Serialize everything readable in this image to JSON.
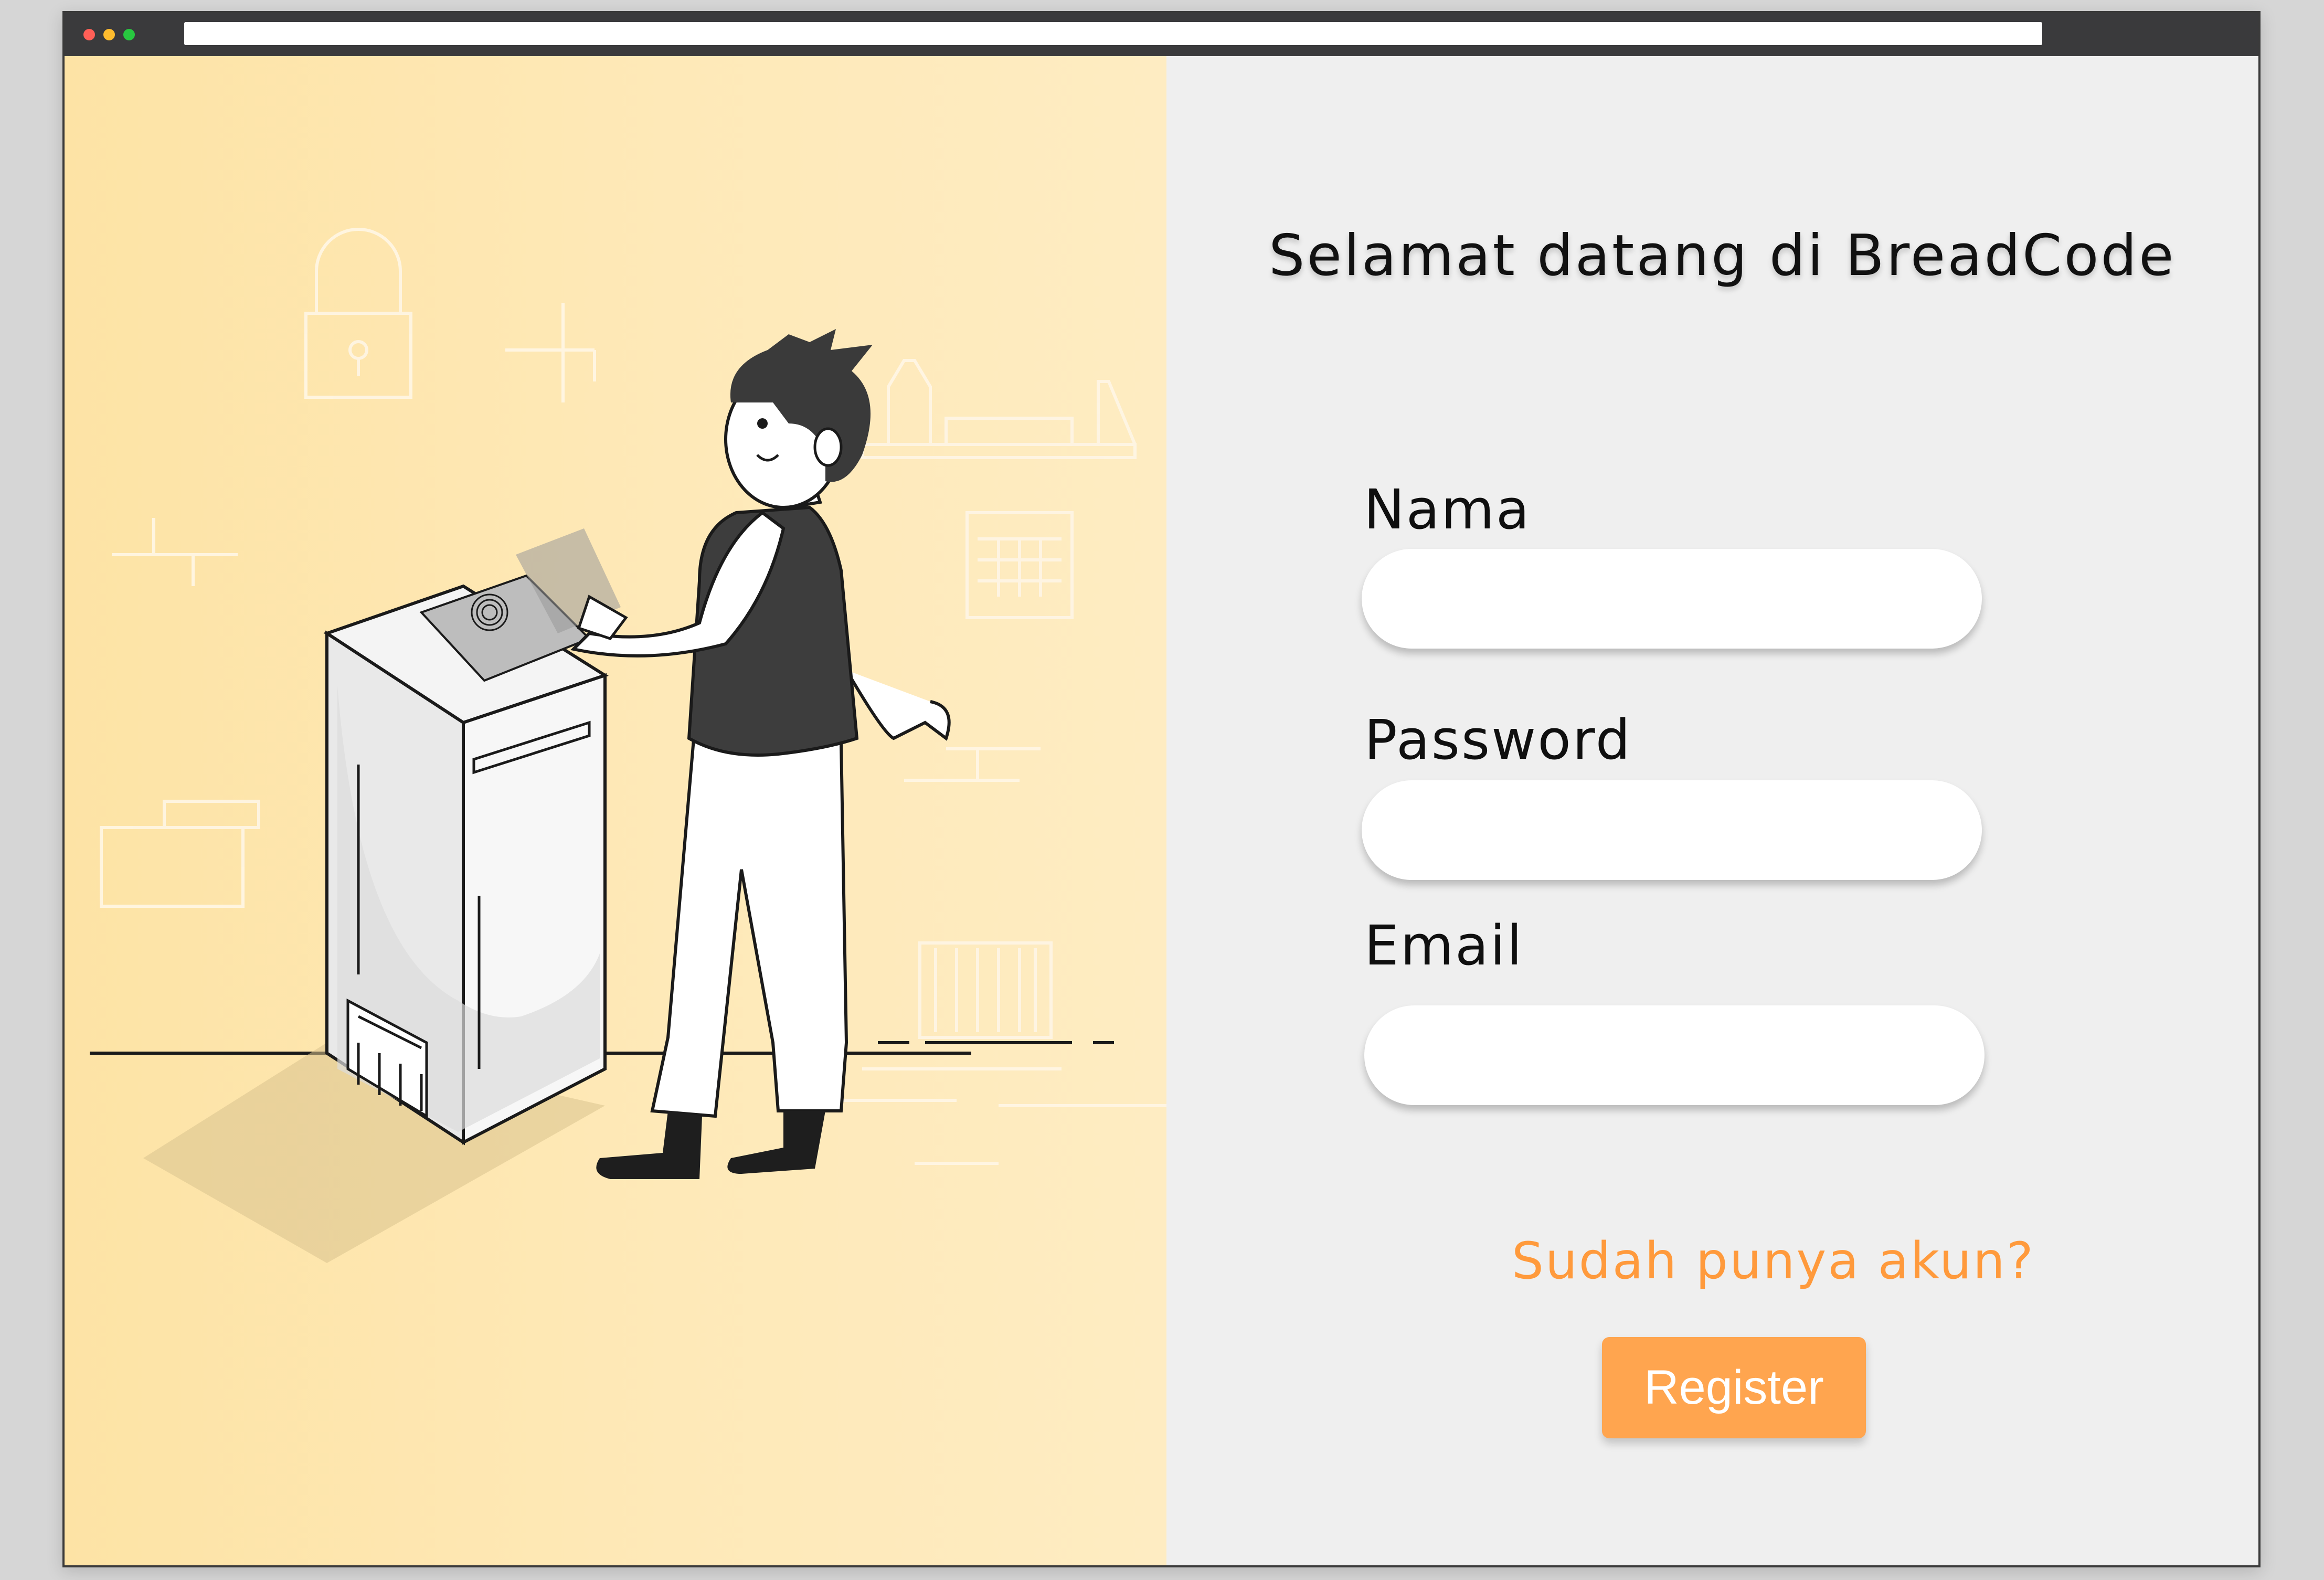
{
  "browser": {
    "window_controls": [
      "close",
      "minimize",
      "maximize"
    ],
    "address": ""
  },
  "illustration": {
    "subject": "person scanning fingerprint at kiosk",
    "icons": [
      "padlock-icon",
      "fingerprint-icon",
      "kiosk-icon",
      "shelf-icon",
      "calendar-icon"
    ]
  },
  "form": {
    "title": "Selamat datang di BreadCode",
    "fields": [
      {
        "label": "Nama",
        "value": "",
        "placeholder": ""
      },
      {
        "label": "Password",
        "value": "",
        "placeholder": ""
      },
      {
        "label": "Email",
        "value": "",
        "placeholder": ""
      }
    ],
    "login_link": "Sudah punya akun?",
    "submit_label": "Register"
  },
  "colors": {
    "accent": "#ffa54f",
    "link": "#ff9a3c",
    "panel_left": "#fde3a5",
    "panel_right": "#efefef"
  }
}
